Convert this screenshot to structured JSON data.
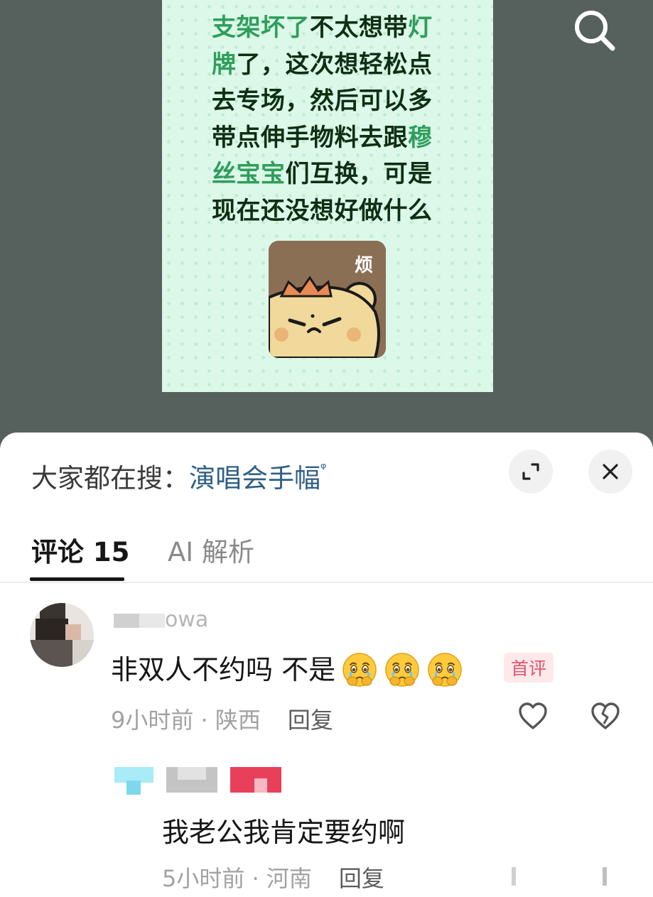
{
  "post": {
    "text_parts": [
      {
        "t": "支架坏了",
        "hl": true
      },
      {
        "t": "不太想带",
        "hl": false
      },
      {
        "t": "灯牌",
        "hl": true
      },
      {
        "t": "了，这次想轻松点去专场，然后可以多带点伸手物料去跟",
        "hl": false
      },
      {
        "t": "穆丝宝宝",
        "hl": true
      },
      {
        "t": "们互换，可是现在还没想好做什么",
        "hl": false
      }
    ],
    "sticker_label": "烦"
  },
  "search_bar": {
    "prefix": "大家都在搜：",
    "keyword": "演唱会手幅",
    "keyword_icon": "ᵠ"
  },
  "icons": {
    "search": "search-icon",
    "expand": "expand-icon",
    "close": "close-icon",
    "like": "heart-icon",
    "dislike": "broken-heart-icon"
  },
  "tabs": {
    "comments_label": "评论 15",
    "ai_label": "AI 解析"
  },
  "comment": {
    "username_visible": "owa",
    "text": "非双人不约吗 不是",
    "emoji_count": 3,
    "badge": "首评",
    "time": "9小时前",
    "location": "陕西",
    "separator": " · ",
    "reply_label": "回复"
  },
  "reply": {
    "text": "我老公我肯定要约啊",
    "time": "5小时前",
    "location": "河南",
    "separator": " · ",
    "reply_label": "回复"
  },
  "colors": {
    "highlight_green": "#2e9e5b",
    "keyword_blue": "#2f5f86",
    "badge_red": "#e0566b",
    "backdrop": "#56615d"
  }
}
